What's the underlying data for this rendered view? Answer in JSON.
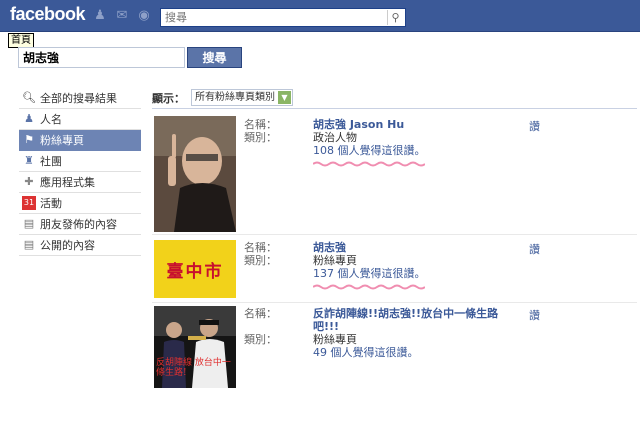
{
  "topbar": {
    "logo": "facebook",
    "search_placeholder": "搜尋"
  },
  "tooltip": "首頁",
  "search": {
    "value": "胡志強",
    "button_label": "搜尋"
  },
  "sidebar": {
    "items": [
      {
        "label": "全部的搜尋結果",
        "icon": "magnifier-icon"
      },
      {
        "label": "人名",
        "icon": "person-icon"
      },
      {
        "label": "粉絲專頁",
        "icon": "flag-icon"
      },
      {
        "label": "社團",
        "icon": "group-icon"
      },
      {
        "label": "應用程式集",
        "icon": "puzzle-icon"
      },
      {
        "label": "活動",
        "icon": "calendar-icon"
      },
      {
        "label": "朋友發佈的內容",
        "icon": "post-icon"
      },
      {
        "label": "公開的內容",
        "icon": "public-post-icon"
      }
    ]
  },
  "filter": {
    "label": "顯示：",
    "selected": "所有粉絲專頁類別"
  },
  "results": [
    {
      "field_name": "名稱：",
      "field_type": "類別：",
      "title": "胡志強 Jason Hu",
      "category": "政治人物",
      "likes": "108 個人覺得這很讚。",
      "like_link": "讚"
    },
    {
      "field_name": "名稱：",
      "field_type": "類別：",
      "title": "胡志強",
      "category": "粉絲專頁",
      "likes": "137 個人覺得這很讚。",
      "like_link": "讚",
      "thumb_text": "臺中市"
    },
    {
      "field_name": "名稱：",
      "field_type": "類別：",
      "title": "反詐胡陣線!!胡志強!!放台中一條生路吧!!!",
      "category": "粉絲專頁",
      "likes": "49 個人覺得這很讚。",
      "like_link": "讚",
      "thumb_text": "反胡陣線 放台中一條生路!"
    }
  ]
}
